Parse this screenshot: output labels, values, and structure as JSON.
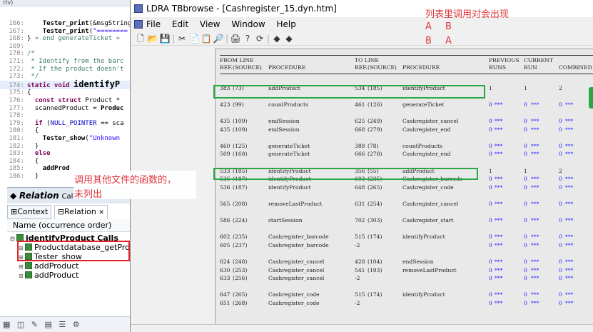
{
  "editor": {
    "topbar": "rtv)",
    "lines": [
      {
        "n": "166:",
        "html": "    <b>Tester_print</b>(&amp;msgString"
      },
      {
        "n": "167:",
        "html": "    <b>Tester_print</b>(<span class='str'>\"========</span>"
      },
      {
        "n": "168:",
        "html": "} <span class='cm'>« end generateTicket »</span>"
      },
      {
        "n": "169:",
        "html": ""
      },
      {
        "n": "170:",
        "html": "<span class='cm'>/*</span>"
      },
      {
        "n": "171:",
        "html": "<span class='cm'> * Identify from the barc</span>"
      },
      {
        "n": "172:",
        "html": "<span class='cm'> * If the product doesn't</span>"
      },
      {
        "n": "173:",
        "html": "<span class='cm'> */</span>"
      },
      {
        "n": "174:",
        "html": "<span class='kw'>static void</span> <span class='fn'>identifyP</span>"
      },
      {
        "n": "175:",
        "html": "{"
      },
      {
        "n": "176:",
        "html": "  <span class='kw'>const struct</span> Product *"
      },
      {
        "n": "177:",
        "html": "  scannedProduct = <b>Produc</b>"
      },
      {
        "n": "178:",
        "html": ""
      },
      {
        "n": "179:",
        "html": "  <span class='kw'>if</span> (<span class='fld'>NULL_POINTER</span> == sca"
      },
      {
        "n": "180:",
        "html": "  {"
      },
      {
        "n": "181:",
        "html": "    <b>Tester_show</b>(<span class='str'>\"Unknown</span>"
      },
      {
        "n": "182:",
        "html": "  }"
      },
      {
        "n": "183:",
        "html": "  <span class='kw'>else</span>"
      },
      {
        "n": "184:",
        "html": "  {"
      },
      {
        "n": "185:",
        "html": "    <b>addProd</b>"
      },
      {
        "n": "186:",
        "html": "  }"
      }
    ]
  },
  "relation": {
    "title": "Relation",
    "title_suffix": "Calls",
    "tab_context": "Context",
    "tab_relation": "Relation",
    "tab_close": "✕",
    "name_header": "Name (occurrence order)",
    "root": "identifyProduct Calls",
    "items": [
      "Productdatabase_getProdu",
      "Tester_show",
      "addProduct",
      "addProduct"
    ]
  },
  "left_bottom_icons": "▦ ◫ ✎ ▤ ☰ ⚙",
  "ldra": {
    "title": "LDRA TBbrowse - [Cashregister_15.dyn.htm]",
    "menu": [
      "File",
      "Edit",
      "View",
      "Window",
      "Help"
    ],
    "toolbar": [
      "🗋",
      "📂",
      "💾",
      "|",
      "✂",
      "📄",
      "📋",
      "🔎",
      "|",
      "🖨",
      "?",
      "⟳",
      "|",
      "◆",
      "◆"
    ]
  },
  "report": {
    "header1": {
      "from": "FROM LINE",
      "to": "TO LINE",
      "prev": "PREVIOUS",
      "curr": "CURRENT"
    },
    "header2": {
      "ref": "REF.",
      "src": "(SOURCE)",
      "proc": "PROCEDURE",
      "ref2": "REF.",
      "src2": "(SOURCE)",
      "proc2": "PROCEDURE",
      "runs": "RUNS",
      "run": "RUN",
      "comb": "COMBINED"
    },
    "groups": [
      [
        {
          "fr": "383",
          "fs": "(73)",
          "fp": "addProduct",
          "tr": "534",
          "ts": "(185)",
          "tp": "identifyProduct",
          "a": "1",
          "b": "1",
          "c": "2"
        }
      ],
      [
        {
          "fr": "423",
          "fs": "(99)",
          "fp": "countProducts",
          "tr": "461",
          "ts": "(126)",
          "tp": "generateTicket",
          "a": "0",
          "b": "0",
          "c": "0"
        }
      ],
      [
        {
          "fr": "435",
          "fs": "(109)",
          "fp": "endSession",
          "tr": "625",
          "ts": "(249)",
          "tp": "Cashregister_cancel",
          "a": "0",
          "b": "0",
          "c": "0"
        },
        {
          "fr": "435",
          "fs": "(109)",
          "fp": "endSession",
          "tr": "668",
          "ts": "(279)",
          "tp": "Cashregister_end",
          "a": "0",
          "b": "0",
          "c": "0"
        }
      ],
      [
        {
          "fr": "460",
          "fs": "(125)",
          "fp": "generateTicket",
          "tr": "388",
          "ts": "(78)",
          "tp": "countProducts",
          "a": "0",
          "b": "0",
          "c": "0"
        },
        {
          "fr": "509",
          "fs": "(168)",
          "fp": "generateTicket",
          "tr": "666",
          "ts": "(278)",
          "tp": "Cashregister_end",
          "a": "0",
          "b": "0",
          "c": "0"
        }
      ],
      [
        {
          "fr": "533",
          "fs": "(185)",
          "fp": "identifyProduct",
          "tr": "356",
          "ts": "(55)",
          "tp": "addProduct",
          "a": "1",
          "b": "1",
          "c": "2"
        },
        {
          "fr": "536",
          "fs": "(187)",
          "fp": "identifyProduct",
          "tr": "603",
          "ts": "(235)",
          "tp": "Cashregister_barcode",
          "a": "0",
          "b": "0",
          "c": "0"
        },
        {
          "fr": "536",
          "fs": "(187)",
          "fp": "identifyProduct",
          "tr": "648",
          "ts": "(265)",
          "tp": "Cashregister_code",
          "a": "0",
          "b": "0",
          "c": "0"
        }
      ],
      [
        {
          "fr": "565",
          "fs": "(208)",
          "fp": "removeLastProduct",
          "tr": "631",
          "ts": "(254)",
          "tp": "Cashregister_cancel",
          "a": "0",
          "b": "0",
          "c": "0"
        }
      ],
      [
        {
          "fr": "586",
          "fs": "(224)",
          "fp": "startSession",
          "tr": "702",
          "ts": "(303)",
          "tp": "Cashregister_start",
          "a": "0",
          "b": "0",
          "c": "0"
        }
      ],
      [
        {
          "fr": "602",
          "fs": "(235)",
          "fp": "Cashregister_barcode",
          "tr": "515",
          "ts": "(174)",
          "tp": "identifyProduct",
          "a": "0",
          "b": "0",
          "c": "0"
        },
        {
          "fr": "605",
          "fs": "(237)",
          "fp": "Cashregister_barcode",
          "tr": "-2",
          "ts": "",
          "tp": "",
          "a": "0",
          "b": "0",
          "c": "0"
        }
      ],
      [
        {
          "fr": "624",
          "fs": "(248)",
          "fp": "Cashregister_cancel",
          "tr": "428",
          "ts": "(104)",
          "tp": "endSession",
          "a": "0",
          "b": "0",
          "c": "0"
        },
        {
          "fr": "630",
          "fs": "(253)",
          "fp": "Cashregister_cancel",
          "tr": "541",
          "ts": "(193)",
          "tp": "removeLastProduct",
          "a": "0",
          "b": "0",
          "c": "0"
        },
        {
          "fr": "633",
          "fs": "(256)",
          "fp": "Cashregister_cancel",
          "tr": "-2",
          "ts": "",
          "tp": "",
          "a": "0",
          "b": "0",
          "c": "0"
        }
      ],
      [
        {
          "fr": "647",
          "fs": "(265)",
          "fp": "Cashregister_code",
          "tr": "515",
          "ts": "(174)",
          "tp": "identifyProduct",
          "a": "0",
          "b": "0",
          "c": "0"
        },
        {
          "fr": "651",
          "fs": "(268)",
          "fp": "Cashregister_code",
          "tr": "-2",
          "ts": "",
          "tp": "",
          "a": "0",
          "b": "0",
          "c": "0"
        }
      ]
    ],
    "stars": "***"
  },
  "annotations": {
    "top_note": "列表里调用对会出现",
    "pair1_a": "A",
    "pair1_b": "B",
    "pair2_a": "B",
    "pair2_b": "A",
    "left_note_1": "调用其他文件的函数的，",
    "left_note_2": "未列出"
  },
  "colors": {
    "red": "#e01f26",
    "green": "#28a745",
    "zero_blue": "#1a1aff"
  }
}
